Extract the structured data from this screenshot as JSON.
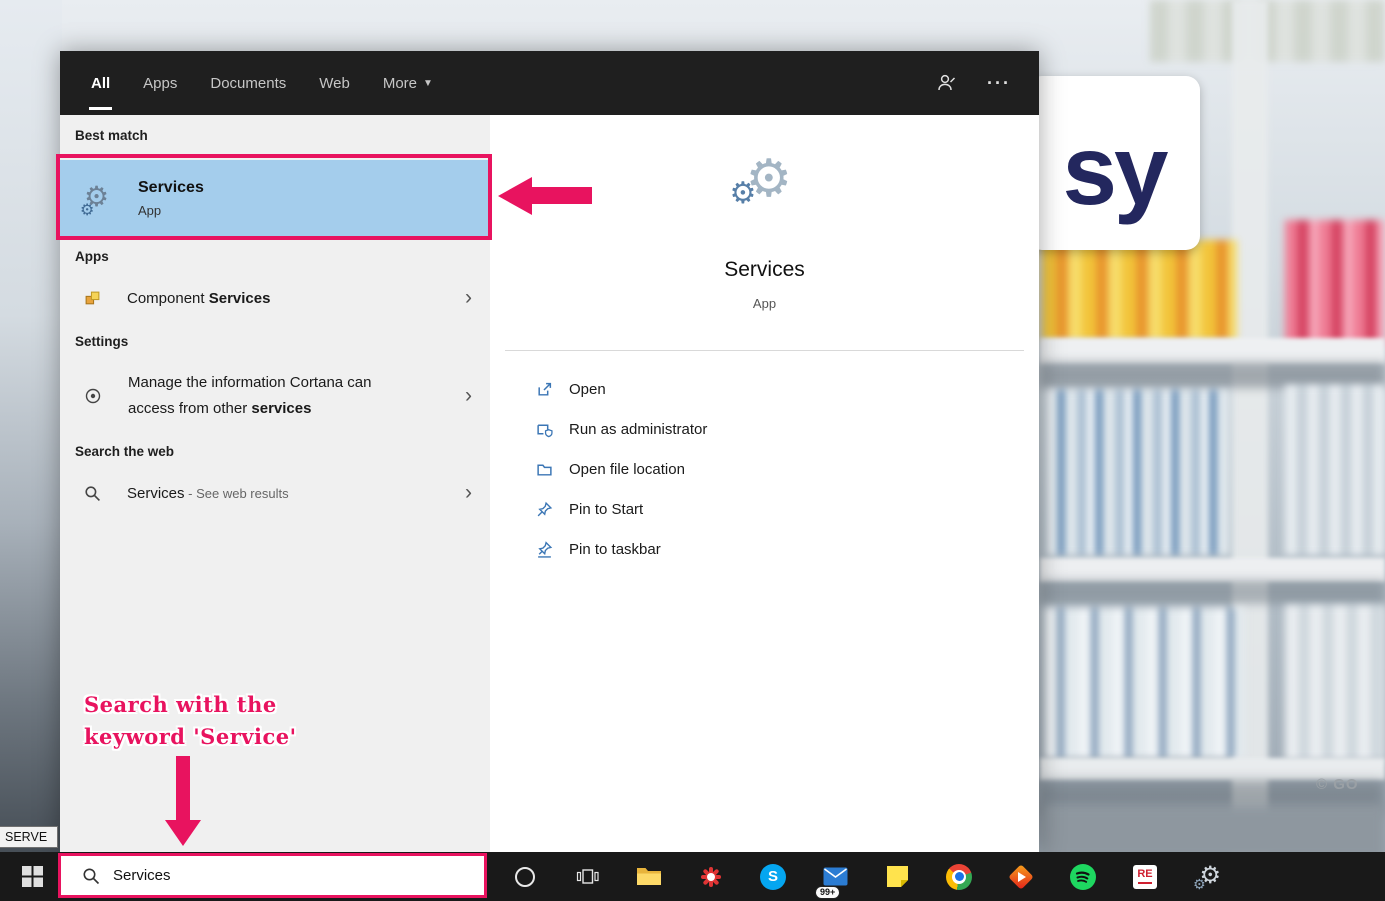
{
  "colors": {
    "annotation_pink": "#e8135f",
    "best_match_highlight": "#a4cdec"
  },
  "flyout": {
    "tabs": [
      {
        "label": "All"
      },
      {
        "label": "Apps"
      },
      {
        "label": "Documents"
      },
      {
        "label": "Web"
      },
      {
        "label": "More"
      }
    ],
    "results": {
      "best_match_label": "Best match",
      "best_match_title": "Services",
      "best_match_subtitle": "App",
      "apps_label": "Apps",
      "apps_item_prefix": "Component ",
      "apps_item_bold": "Services",
      "settings_label": "Settings",
      "settings_item_line1": "Manage the information Cortana can",
      "settings_item_line2_prefix": "access from other ",
      "settings_item_line2_bold": "services",
      "web_label": "Search the web",
      "web_item_term": "Services",
      "web_item_suffix": " - See web results"
    },
    "preview": {
      "title": "Services",
      "subtitle": "App",
      "actions": [
        {
          "label": "Open"
        },
        {
          "label": "Run as administrator"
        },
        {
          "label": "Open file location"
        },
        {
          "label": "Pin to Start"
        },
        {
          "label": "Pin to taskbar"
        }
      ]
    }
  },
  "annotation": {
    "accent": "#e8135f",
    "line1": "Search with the",
    "line2": "keyword 'Service'"
  },
  "taskbar": {
    "search_value": "Services",
    "mail_badge": "99+",
    "skype_letter": "S",
    "re_label": "RE"
  },
  "desktop": {
    "brand_text": "sy",
    "watermark": "© GO",
    "tooltip_text": "SERVE"
  }
}
